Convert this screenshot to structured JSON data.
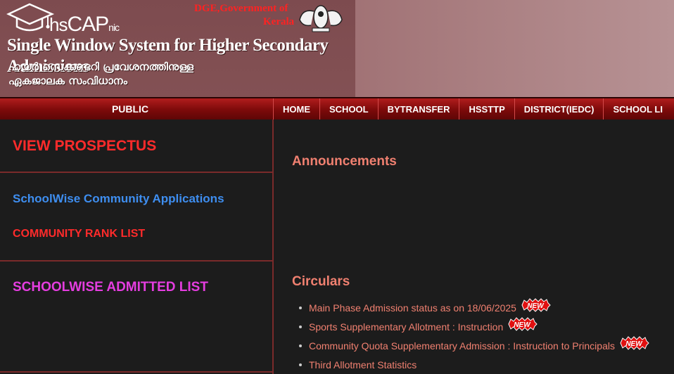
{
  "header": {
    "logo_hs": "hs",
    "logo_cap": "CAP",
    "logo_nic": "nic",
    "dge_line1": "DGE,Government of",
    "dge_line2": "Kerala",
    "title": "Single Window System for Higher Secondary Admissions",
    "malayalam_line1": "ഹയർ സെക്കണ്ടറി പ്രവേശനത്തിനുള്ള",
    "malayalam_line2": "ഏകജാലക സംവിധാനം"
  },
  "nav": {
    "public_label": "PUBLIC",
    "items": [
      "HOME",
      "SCHOOL",
      "BYTRANSFER",
      "HSSTTP",
      "DISTRICT(IEDC)",
      "SCHOOL LI"
    ]
  },
  "sidebar": {
    "view_prospectus": "VIEW PROSPECTUS",
    "schoolwise_community": "SchoolWise Community Applications",
    "community_rank_list": "COMMUNITY RANK LIST",
    "schoolwise_admitted": "SCHOOLWISE ADMITTED LIST"
  },
  "main": {
    "announcements_title": "Announcements",
    "circulars_title": "Circulars",
    "circulars": [
      {
        "text": "Main Phase Admission status as on 18/06/2025",
        "is_new": true
      },
      {
        "text": "Sports Supplementary Allotment : Instruction",
        "is_new": true
      },
      {
        "text": "Community Quota Supplementary Admission : Instruction to Principals",
        "is_new": true
      },
      {
        "text": "Third Allotment Statistics",
        "is_new": false
      }
    ],
    "new_badge_text": "NEW"
  },
  "colors": {
    "page_bg": "#1c1c1c",
    "nav_red": "#7c0a0a",
    "link_red": "#ff2b2b",
    "link_blue": "#3e8ef0",
    "link_magenta": "#e53de0",
    "salmon": "#f08070"
  }
}
